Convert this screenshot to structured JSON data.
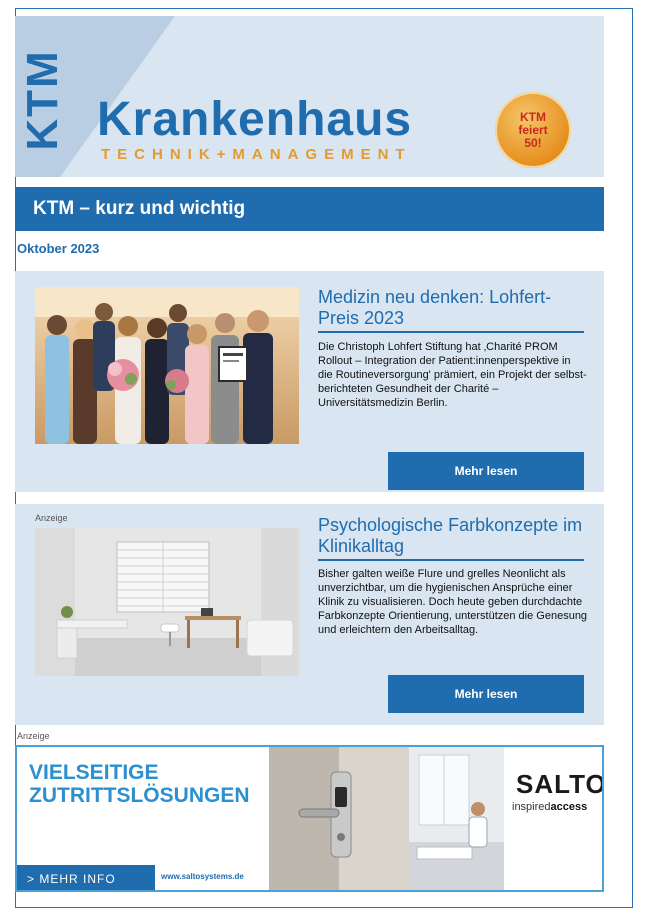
{
  "header": {
    "logo_vertical": "KTM",
    "title": "Krankenhaus",
    "subtitle": "TECHNIK+MANAGEMENT",
    "badge_lines": [
      "KTM",
      "feiert",
      "50!"
    ]
  },
  "section": {
    "title": "KTM – kurz und wichtig"
  },
  "issue_date": "Oktober 2023",
  "articles": [
    {
      "sponsored_label": "",
      "headline": "Medizin neu denken: Lohfert-Preis 2023",
      "text": "Die Christoph Lohfert Stiftung hat ‚Charité PROM Rollout – Integration der Patient:innenperspektive in die Routineversorgung' prämiert, ein Projekt der selbst-berichteten Gesundheit der Charité – Universitätsmedizin Berlin.",
      "button": "Mehr lesen"
    },
    {
      "sponsored_label": "Anzeige",
      "headline": "Psychologische Farbkonzepte im Klinikalltag",
      "text": "Bisher galten weiße Flure und grelles Neonlicht als unverzichtbar, um die hygienischen Ansprüche einer Klinik zu visualisieren. Doch heute geben durchdachte Farbkonzepte Orientierung, unterstützen die Genesung und erleichtern den Arbeitsalltag.",
      "button": "Mehr lesen"
    }
  ],
  "ad": {
    "label": "Anzeige",
    "headline_line1": "VIELSEITIGE",
    "headline_line2": "ZUTRITTSLÖSUNGEN",
    "cta": "> MEHR INFO",
    "url": "www.saltosystems.de",
    "brand": "SALTO",
    "brand_tagline_prefix": "inspired",
    "brand_tagline_bold": "access"
  },
  "colors": {
    "primary_blue": "#1f6cae",
    "light_blue_bg": "#d9e5f1",
    "accent_orange": "#e49a2e",
    "ad_blue": "#2b8fd0"
  }
}
